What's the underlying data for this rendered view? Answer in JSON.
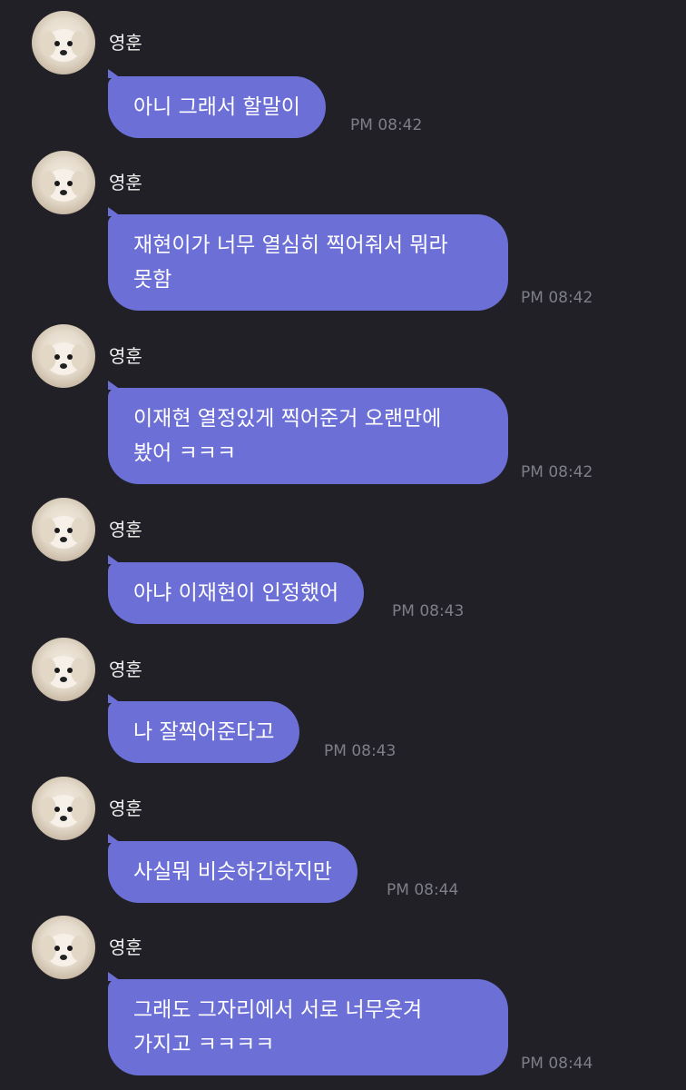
{
  "sender_name": "영훈",
  "messages": [
    {
      "text": "아니 그래서 할말이",
      "time": "PM 08:42"
    },
    {
      "text": "재현이가 너무 열심히 찍어줘서 뭐라\n못함",
      "time": "PM 08:42"
    },
    {
      "text": "이재현 열정있게 찍어준거 오랜만에\n봤어 ㅋㅋㅋ",
      "time": "PM 08:42"
    },
    {
      "text": "아냐 이재현이 인정했어",
      "time": "PM 08:43"
    },
    {
      "text": "나 잘찍어준다고",
      "time": "PM 08:43"
    },
    {
      "text": "사실뭐 비슷하긴하지만",
      "time": "PM 08:44"
    },
    {
      "text": "그래도 그자리에서 서로 너무웃겨\n가지고 ㅋㅋㅋㅋ",
      "time": "PM 08:44"
    }
  ],
  "colors": {
    "background": "#202026",
    "bubble": "#6c6fd6",
    "time": "#7e7e86"
  },
  "avatar_icon": "puppy-avatar-icon"
}
